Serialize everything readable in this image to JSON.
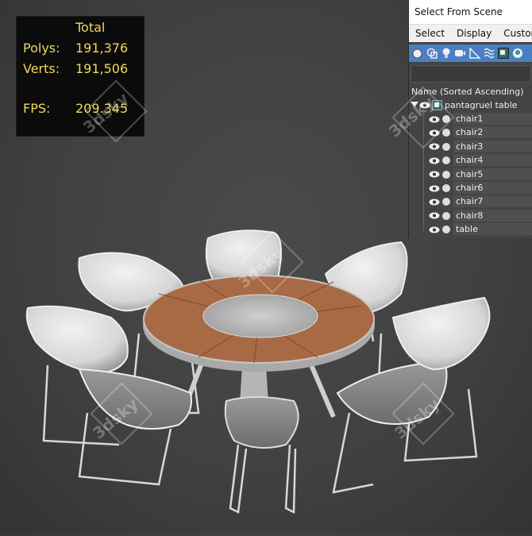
{
  "stats": {
    "header": "Total",
    "rows": [
      {
        "label": "Polys:",
        "value": "191,376"
      },
      {
        "label": "Verts:",
        "value": "191,506"
      },
      {
        "label": "FPS:",
        "value": "209.345"
      }
    ]
  },
  "explorer": {
    "title": "Select From Scene",
    "menu": [
      "Select",
      "Display",
      "Customize"
    ],
    "toolbar_icons": [
      "geometry-icon",
      "shapes-icon",
      "lights-icon",
      "cameras-icon",
      "helpers-icon",
      "space-warps-icon",
      "groups-icon",
      "xrefs-icon"
    ],
    "search_value": "",
    "column_header": "Name (Sorted Ascending)",
    "root": {
      "name": "pantagruel table"
    },
    "children": [
      {
        "name": "chair1"
      },
      {
        "name": "chair2"
      },
      {
        "name": "chair3"
      },
      {
        "name": "chair4"
      },
      {
        "name": "chair5"
      },
      {
        "name": "chair6"
      },
      {
        "name": "chair7"
      },
      {
        "name": "chair8"
      },
      {
        "name": "table"
      }
    ]
  },
  "watermark": "3dsky",
  "colors": {
    "stats_text": "#f1d85a",
    "toolbar_blue": "#4a7fc4",
    "table_wood": "#a86a45",
    "marble": "#b9b9b9",
    "chair_shell": "#e4e4e4",
    "viewport_bg": "#444444"
  }
}
